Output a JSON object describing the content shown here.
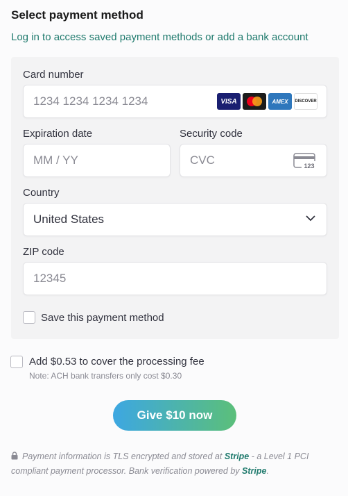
{
  "header": {
    "title": "Select payment method",
    "login_link": "Log in to access saved payment methods or add a bank account"
  },
  "form": {
    "card_number": {
      "label": "Card number",
      "placeholder": "1234 1234 1234 1234"
    },
    "card_brands": {
      "visa": "VISA",
      "amex": "AMEX",
      "discover": "DISCOVER"
    },
    "expiration": {
      "label": "Expiration date",
      "placeholder": "MM / YY"
    },
    "security": {
      "label": "Security code",
      "placeholder": "CVC",
      "icon_text": "123"
    },
    "country": {
      "label": "Country",
      "value": "United States"
    },
    "zip": {
      "label": "ZIP code",
      "placeholder": "12345"
    },
    "save_method": {
      "label": "Save this payment method",
      "checked": false
    }
  },
  "fee": {
    "label": "Add $0.53 to cover the processing fee",
    "note": "Note: ACH bank transfers only cost $0.30",
    "checked": false
  },
  "submit": {
    "label": "Give $10 now"
  },
  "footer": {
    "text_1": "Payment information is TLS encrypted and stored at ",
    "stripe_1": "Stripe",
    "text_2": " - a Level 1 PCI compliant payment processor. Bank verification powered by ",
    "stripe_2": "Stripe",
    "text_3": "."
  },
  "colors": {
    "accent": "#1f7a6d",
    "button_gradient_start": "#3da7e2",
    "button_gradient_end": "#5bbf7a"
  }
}
